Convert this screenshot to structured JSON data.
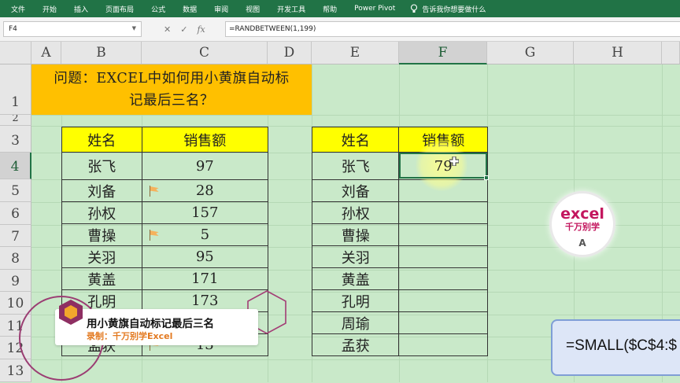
{
  "ribbon": {
    "tabs": [
      "文件",
      "开始",
      "插入",
      "页面布局",
      "公式",
      "数据",
      "审阅",
      "视图",
      "开发工具",
      "帮助",
      "Power Pivot"
    ],
    "tell_me": "告诉我你想要做什么"
  },
  "formula_bar": {
    "name_box": "F4",
    "formula": "=RANDBETWEEN(1,199)"
  },
  "columns": [
    "A",
    "B",
    "C",
    "D",
    "E",
    "F",
    "G",
    "H"
  ],
  "rows": [
    "1",
    "2",
    "3",
    "4",
    "5",
    "6",
    "7",
    "8",
    "9",
    "10",
    "11",
    "12",
    "13"
  ],
  "title_cell": {
    "line1": "问题：EXCEL中如何用小黄旗自动标",
    "line2": "记最后三名？"
  },
  "left_table": {
    "headers": [
      "姓名",
      "销售额"
    ],
    "rows": [
      {
        "name": "张飞",
        "value": "97",
        "flag": false
      },
      {
        "name": "刘备",
        "value": "28",
        "flag": true
      },
      {
        "name": "孙权",
        "value": "157",
        "flag": false
      },
      {
        "name": "曹操",
        "value": "5",
        "flag": true
      },
      {
        "name": "关羽",
        "value": "95",
        "flag": false
      },
      {
        "name": "黄盖",
        "value": "171",
        "flag": false
      },
      {
        "name": "孔明",
        "value": "173",
        "flag": false
      },
      {
        "name": "",
        "value": "",
        "flag": false
      },
      {
        "name": "孟获",
        "value": "13",
        "flag": true
      }
    ]
  },
  "right_table": {
    "headers": [
      "姓名",
      "销售额"
    ],
    "rows": [
      {
        "name": "张飞",
        "value": "79"
      },
      {
        "name": "刘备",
        "value": ""
      },
      {
        "name": "孙权",
        "value": ""
      },
      {
        "name": "曹操",
        "value": ""
      },
      {
        "name": "关羽",
        "value": ""
      },
      {
        "name": "黄盖",
        "value": ""
      },
      {
        "name": "孔明",
        "value": ""
      },
      {
        "name": "周瑜",
        "value": ""
      },
      {
        "name": "孟获",
        "value": ""
      }
    ]
  },
  "logo": {
    "line1": "excel",
    "line2": "千万别学",
    "line3": "A"
  },
  "callout": {
    "text": "=SMALL($C$4:$"
  },
  "caption": {
    "title": "用小黄旗自动标记最后三名",
    "author": "录制：千万别学Excel"
  },
  "colors": {
    "ribbon": "#217346",
    "header_fill": "#ffff00",
    "title_fill": "#ffc000",
    "sheet_bg": "#c9e9c9"
  }
}
